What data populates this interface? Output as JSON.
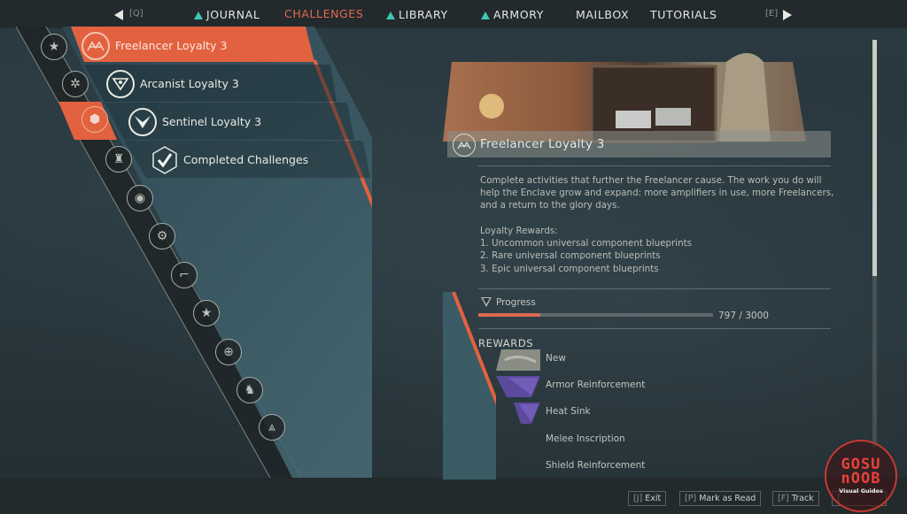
{
  "nav": {
    "prev_key": "[Q]",
    "next_key": "[E]",
    "tabs": [
      {
        "label": "JOURNAL",
        "alert": true,
        "active": false
      },
      {
        "label": "CHALLENGES",
        "alert": false,
        "active": true
      },
      {
        "label": "LIBRARY",
        "alert": true,
        "active": false
      },
      {
        "label": "ARMORY",
        "alert": true,
        "active": false
      },
      {
        "label": "MAILBOX",
        "alert": false,
        "active": false
      },
      {
        "label": "TUTORIALS",
        "alert": false,
        "active": false
      }
    ],
    "alert_color": "#3fc6b5",
    "active_color": "#e46a4c"
  },
  "rail": {
    "categories": [
      {
        "icon": "hex-star-icon",
        "glyph": "★",
        "active": false
      },
      {
        "icon": "starburst-icon",
        "glyph": "✲",
        "active": false
      },
      {
        "icon": "hexagons-icon",
        "glyph": "⬢",
        "active": true
      },
      {
        "icon": "javelin-icon",
        "glyph": "♜",
        "active": false
      },
      {
        "icon": "helmet-icon",
        "glyph": "◉",
        "active": false
      },
      {
        "icon": "gear-icon",
        "glyph": "⚙",
        "active": false
      },
      {
        "icon": "weapon-icon",
        "glyph": "⌐",
        "active": false
      },
      {
        "icon": "star-icon",
        "glyph": "★",
        "active": false
      },
      {
        "icon": "crosshair-icon",
        "glyph": "⊕",
        "active": false
      },
      {
        "icon": "figure-icon",
        "glyph": "♞",
        "active": false
      },
      {
        "icon": "freelancer-icon",
        "glyph": "⩓",
        "active": false
      }
    ]
  },
  "list": {
    "items": [
      {
        "label": "Freelancer Loyalty 3",
        "icon": "freelancer-emblem-icon",
        "selected": true
      },
      {
        "label": "Arcanist Loyalty 3",
        "icon": "arcanist-emblem-icon",
        "selected": false
      },
      {
        "label": "Sentinel Loyalty 3",
        "icon": "sentinel-emblem-icon",
        "selected": false
      },
      {
        "label": "Completed Challenges",
        "icon": "checkmark-icon",
        "selected": false
      }
    ],
    "accent_color": "#e2613f"
  },
  "detail": {
    "title": "Freelancer Loyalty 3",
    "description": "Complete activities that further the Freelancer cause. The work you do will help the Enclave grow and expand: more amplifiers in use, more Freelancers, and a return to the glory days.",
    "loyalty_rewards_header": "Loyalty Rewards:",
    "loyalty_rewards": [
      "1. Uncommon universal component blueprints",
      "2. Rare universal component blueprints",
      "3. Epic universal component blueprints"
    ],
    "progress": {
      "label": "Progress",
      "current": 797,
      "total": 3000,
      "text": "797 / 3000",
      "fill_color": "#d86a52"
    },
    "rewards_header": "REWARDS",
    "rewards": [
      {
        "name": "New",
        "thumb": "vinyl-thumb"
      },
      {
        "name": "Armor Reinforcement",
        "thumb": "epic-purple-thumb"
      },
      {
        "name": "Heat Sink",
        "thumb": "epic-purple-thumb"
      },
      {
        "name": "Melee Inscription",
        "thumb": "none"
      },
      {
        "name": "Shield Reinforcement",
        "thumb": "none"
      }
    ]
  },
  "scrollbar": {
    "position": 0.0,
    "visible_fraction": 0.58
  },
  "footer": {
    "buttons": [
      {
        "key": "[J]",
        "label": "Exit"
      },
      {
        "key": "[P]",
        "label": "Mark as Read"
      },
      {
        "key": "[F]",
        "label": "Track"
      },
      {
        "key": "[",
        "label": ""
      }
    ]
  },
  "watermark": {
    "line1": "GOSU",
    "line2": "nOOB",
    "line3": "Visual Guides"
  }
}
